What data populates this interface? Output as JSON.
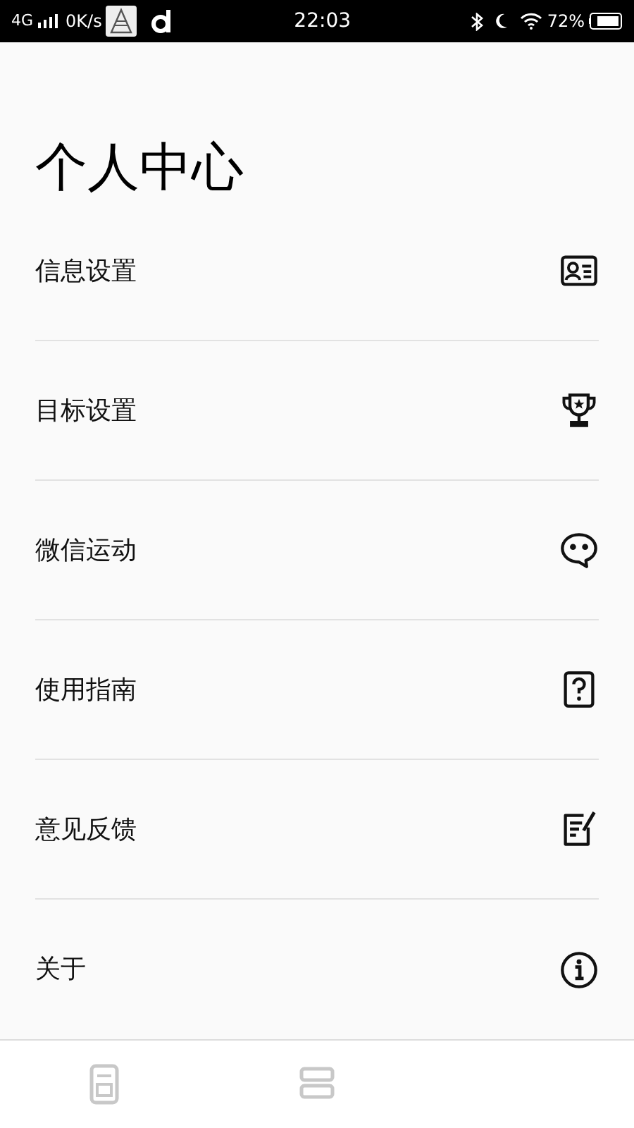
{
  "status_bar": {
    "network": "4G",
    "speed": "0K/s",
    "time": "22:03",
    "battery": "72%"
  },
  "title": "个人中心",
  "menu_items": [
    {
      "label": "信息设置"
    },
    {
      "label": "目标设置"
    },
    {
      "label": "微信运动"
    },
    {
      "label": "使用指南"
    },
    {
      "label": "意见反馈"
    },
    {
      "label": "关于"
    }
  ],
  "bottom_tabs": [
    {
      "selected": false
    },
    {
      "selected": false
    }
  ]
}
